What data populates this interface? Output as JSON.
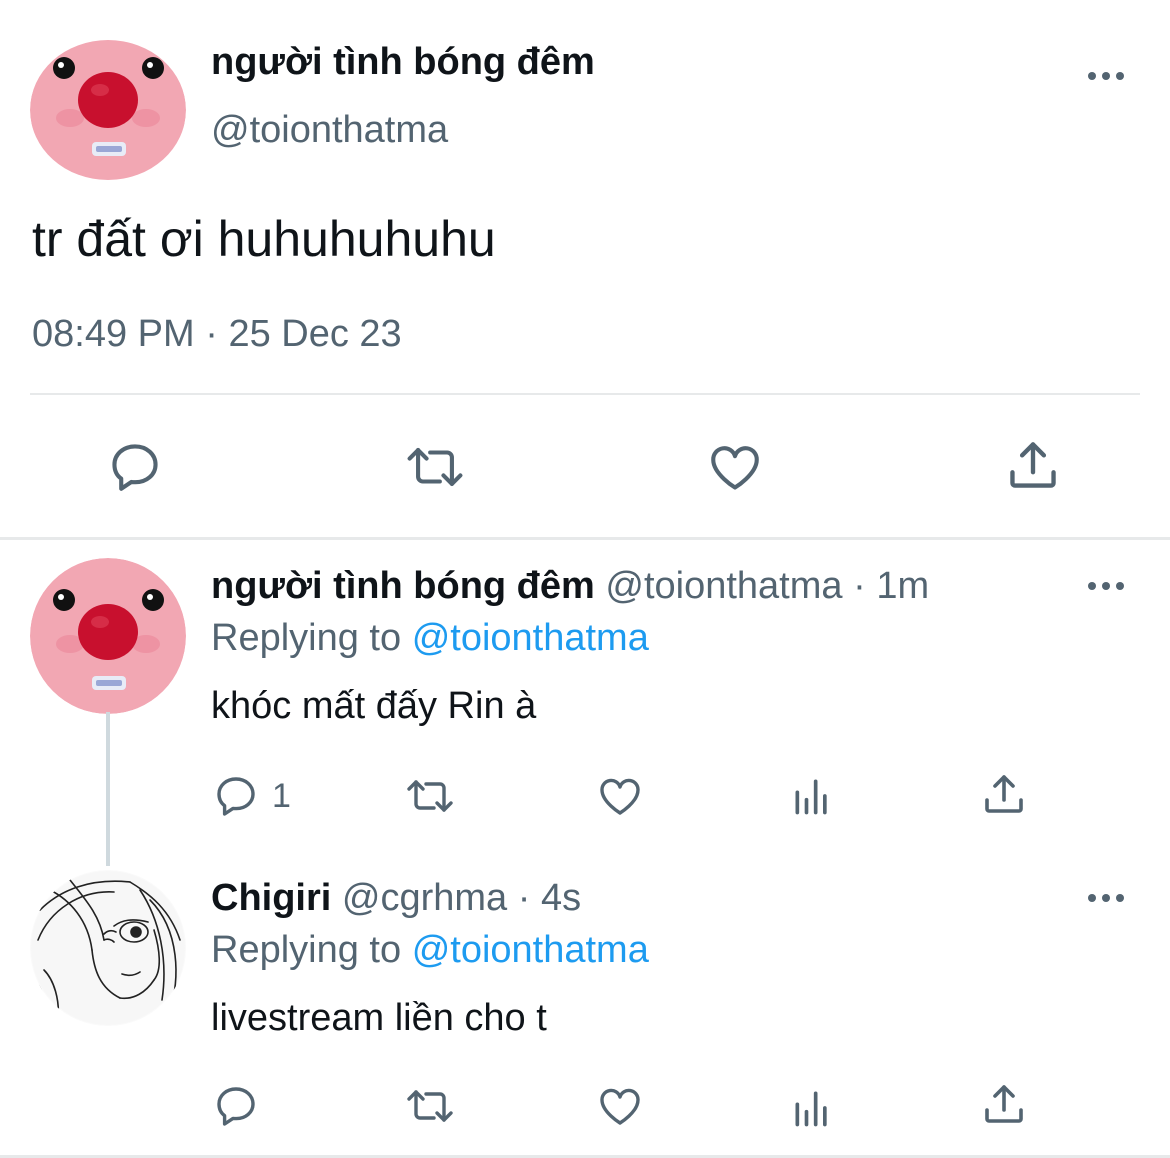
{
  "main_tweet": {
    "display_name": "người tình bóng đêm",
    "handle": "@toionthatma",
    "text": "tr đất ơi huhuhuhuhu",
    "time": "08:49 PM",
    "sep": "·",
    "date": "25 Dec 23"
  },
  "replies": [
    {
      "display_name": "người tình bóng đêm",
      "handle": "@toionthatma",
      "sep": "·",
      "age": "1m",
      "replying_prefix": "Replying to",
      "replying_handle": "@toionthatma",
      "text": "khóc mất đấy Rin à",
      "reply_count": "1"
    },
    {
      "display_name": "Chigiri",
      "handle": "@cgrhma",
      "sep": "·",
      "age": "4s",
      "replying_prefix": "Replying to",
      "replying_handle": "@toionthatma",
      "text": "livestream liền cho t",
      "reply_count": ""
    }
  ],
  "colors": {
    "accent": "#1d9bf0",
    "secondary_text": "#536471",
    "divider": "#e7e9ea",
    "avatar_pink": "#f2a7b3",
    "avatar_nose": "#c8102e"
  },
  "icons": [
    "more-icon",
    "reply-icon",
    "retweet-icon",
    "like-icon",
    "share-icon",
    "analytics-icon"
  ]
}
